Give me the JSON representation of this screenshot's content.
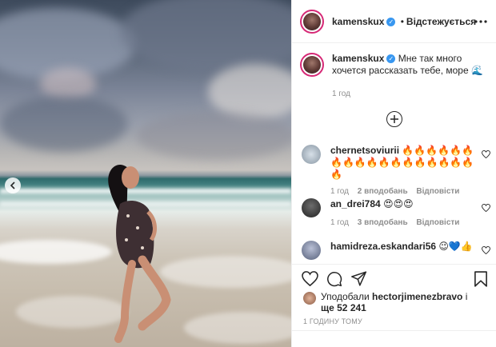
{
  "post": {
    "author": "kamenskux",
    "follow_label": "Відстежується",
    "caption": "Мне так много хочется рассказать тебе, море 🌊",
    "caption_time": "1 год"
  },
  "comments": [
    {
      "user": "chernetsoviurii",
      "text": "🔥🔥🔥🔥🔥🔥🔥🔥🔥🔥🔥🔥🔥🔥🔥🔥🔥🔥🔥",
      "time": "1 год",
      "likes": "2 вподобань",
      "reply": "Відповісти"
    },
    {
      "user": "an_drei784",
      "text": "😍😍😍",
      "time": "1 год",
      "likes": "3 вподобань",
      "reply": "Відповісти"
    },
    {
      "user": "hamidreza.eskandari56",
      "text": "😉💙👍"
    }
  ],
  "likes_line": {
    "prefix": "Уподобали",
    "user": "hectorjimenezbravo",
    "connector": "і",
    "rest": "ще 52 241"
  },
  "posted_label": "1 ГОДИНУ ТОМУ",
  "icons": {
    "prev": "chevron-left-icon",
    "more": "more-horizontal-icon",
    "add": "plus-circle-icon",
    "like": "heart-icon",
    "comment": "comment-icon",
    "share": "send-icon",
    "save": "bookmark-icon"
  }
}
